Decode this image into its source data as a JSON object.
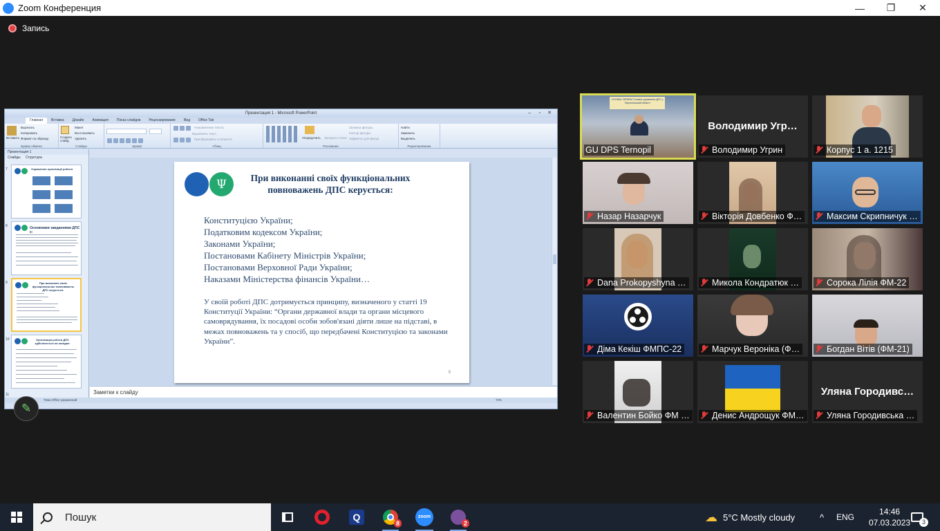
{
  "window": {
    "title": "Zoom Конференция",
    "minimize": "—",
    "restore": "❐",
    "close": "✕"
  },
  "recording": {
    "label": "Запись"
  },
  "powerpoint": {
    "title": "Презентация 1 - Microsoft PowerPoint",
    "tabs": [
      "Главная",
      "Вставка",
      "Дизайн",
      "Анимация",
      "Показ слайдов",
      "Рецензирование",
      "Вид",
      "Office Tab"
    ],
    "ribbon": {
      "clipboard": [
        "Вырезать",
        "Копировать",
        "Формат по образцу"
      ],
      "paste": "Вставить",
      "slides": [
        "Макет",
        "Восстановить",
        "Удалить"
      ],
      "create_slide": "Создать слайд",
      "paragraph_tools": [
        "Направление текста",
        "Выровнять текст",
        "Преобразовать в SmartArt"
      ],
      "drawing_tools": [
        "Заливка фигуры",
        "Контур фигуры",
        "Эффекты для фигур"
      ],
      "arrange": "Упорядочить",
      "quick_styles": "Экспресс-стили",
      "editing": [
        "Найти",
        "Заменить",
        "Выделить"
      ],
      "group_labels": [
        "Буфер обмена",
        "Слайды",
        "Шрифт",
        "Абзац",
        "Рисование",
        "Редактирование"
      ]
    },
    "doc_tab": "Презентация 1",
    "panel_tabs": [
      "Слайды",
      "Структура"
    ],
    "thumb_numbers": [
      "7",
      "8",
      "9",
      "10",
      "11"
    ],
    "thumbs": [
      {
        "title": "Управління організації роботи"
      },
      {
        "title": "Основними завданнями ДПС є:"
      },
      {
        "title": "При виконанні своїх функціональних повноважень ДПС керується:"
      },
      {
        "title": "Організація роботи ДПС здійснюється на засадах:"
      }
    ],
    "slide": {
      "emblem": "Ψ",
      "title": "При виконанні своїх функціональних повноважень ДПС керується:",
      "list": [
        "Конституцією України;",
        "Податковим кодексом України;",
        "Законами України;",
        "Постановами Кабінету Міністрів України;",
        "Постановами Верховної Ради України;",
        "Наказами Міністерства фінансів України…"
      ],
      "paragraph": "У своїй роботі ДПС дотримується принципу, визначеного у статті 19 Конституції України: “Органи державної влади та органи місцевого самоврядування, їх посадові особи зобов'язані діяти лише на підставі, в межах повноважень та у спосіб, що передбачені Конституцією та законами України”.",
      "page_number": "9"
    },
    "notes_placeholder": "Заметки к слайду",
    "status": "Тема Office   украинский",
    "zoom": "72%"
  },
  "pen_icon": "✎",
  "participants": [
    {
      "name": "GU DPS Ternopil",
      "muted": false,
      "active": true,
      "kind": "video",
      "sign": "СЛУЖБА УКРАЇНИ Головне управління ДПС у Тернопільській області"
    },
    {
      "name": "Володимир Угрин",
      "big": "Володимир  Угр…",
      "muted": true,
      "kind": "name"
    },
    {
      "name": "Корпус 1 а. 1215",
      "muted": true,
      "kind": "video"
    },
    {
      "name": "Назар Назарчук",
      "muted": true,
      "kind": "video"
    },
    {
      "name": "Вікторія Довбенко Ф…",
      "muted": true,
      "kind": "video"
    },
    {
      "name": "Максим Скрипничук …",
      "muted": true,
      "kind": "video"
    },
    {
      "name": "Dana Prokopyshyna …",
      "muted": true,
      "kind": "video"
    },
    {
      "name": "Микола Кондратюк …",
      "muted": true,
      "kind": "video"
    },
    {
      "name": "Сорока Лілія ФМ-22",
      "muted": true,
      "kind": "video"
    },
    {
      "name": "Діма Кекіш ФМПС-22",
      "muted": true,
      "kind": "obs"
    },
    {
      "name": "Марчук Вероніка (Ф…",
      "muted": true,
      "kind": "video"
    },
    {
      "name": "Богдан Вітів (ФМ-21)",
      "muted": true,
      "kind": "video"
    },
    {
      "name": "Валентин Бойко ФМ …",
      "muted": true,
      "kind": "video"
    },
    {
      "name": "Денис Андрощук ФМ…",
      "muted": true,
      "kind": "flag"
    },
    {
      "name": "Уляна Городивська …",
      "big": "Уляна  Городивс…",
      "muted": true,
      "kind": "name"
    }
  ],
  "taskbar": {
    "search_placeholder": "Пошук",
    "weather": "5°C  Mostly cloudy",
    "language": "ENG",
    "time": "14:46",
    "date": "07.03.2023",
    "notifications": "3",
    "chrome_badge": "8",
    "viber_badge": "2",
    "zoom_label": "zoom",
    "tray_arrow": "^"
  },
  "colors": {
    "active_speaker": "#d9dc53",
    "muted": "#e03b3b",
    "zoom_blue": "#2d8cff",
    "slide_blue": "#1f62b4",
    "slide_green": "#23a870"
  }
}
